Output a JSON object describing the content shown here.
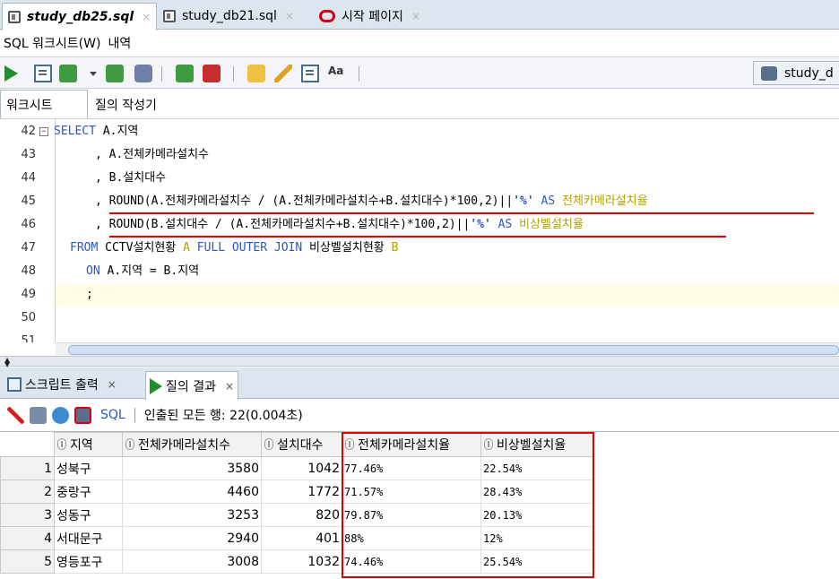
{
  "editor_tabs": [
    {
      "label": "study_db25.sql",
      "icon": "sql-file-icon",
      "active": true
    },
    {
      "label": "study_db21.sql",
      "icon": "sql-file-icon",
      "active": false
    },
    {
      "label": "시작 페이지",
      "icon": "oracle-icon",
      "active": false
    }
  ],
  "tab_close_glyph": "×",
  "sub_tabs": {
    "worksheet_w": "SQL 워크시트(W)",
    "history": "내역"
  },
  "toolbar": {
    "icons": [
      "run-statement-icon",
      "run-script-icon",
      "commit-icon",
      "rollback-icon",
      "explain-plan-icon",
      "autotrace-icon",
      "sql-tuning-icon",
      "clear-icon",
      "history-icon",
      "format-icon"
    ],
    "connection": "study_d"
  },
  "worksheet_tabs": {
    "worksheet": "워크시트",
    "query_builder": "질의 작성기"
  },
  "code": {
    "line_numbers": [
      "42",
      "43",
      "44",
      "45",
      "46",
      "47",
      "48",
      "49",
      "50",
      "51"
    ],
    "fold_glyph": "−",
    "l42_kw": "SELECT",
    "l42_rest": " A.지역",
    "l43": ", A.전체카메라설치수",
    "l44": ", B.설치대수",
    "l45_lead": ", ",
    "l45_body": "ROUND(A.전체카메라설치수 / (A.전체카메라설치수+B.설치대수)*100,2)||",
    "l45_str": "'%'",
    "l45_as": " AS ",
    "l45_alias": "전체카메라설치율",
    "l46_lead": ", ",
    "l46_body": "ROUND(B.설치대수 / (A.전체카메라설치수+B.설치대수)*100,2)||",
    "l46_str": "'%'",
    "l46_as": " AS ",
    "l46_alias": "비상벨설치율",
    "l47_kw1": "FROM",
    "l47_t1": " CCTV설치현황 ",
    "l47_a1": "A",
    "l47_kw2": " FULL OUTER JOIN",
    "l47_t2": " 비상벨설치현황 ",
    "l47_a2": "B",
    "l48_kw": "ON",
    "l48_rest": " A.지역 = B.지역",
    "l49": ";"
  },
  "result_tabs": {
    "script_output": "스크립트 출력",
    "query_result": "질의 결과",
    "close": "×"
  },
  "result_toolbar": {
    "icons": [
      "pin-icon",
      "print-icon",
      "refresh-icon",
      "cancel-icon"
    ],
    "sql_label": "SQL",
    "status": "인출된 모든 행: 22(0.004초)"
  },
  "result_grid": {
    "columns": [
      "지역",
      "전체카메라설치수",
      "설치대수",
      "전체카메라설치율",
      "비상벨설치율"
    ],
    "rows": [
      {
        "n": "1",
        "region": "성북구",
        "cameras": "3580",
        "bells": "1042",
        "cam_rate": "77.46%",
        "bell_rate": "22.54%"
      },
      {
        "n": "2",
        "region": "중랑구",
        "cameras": "4460",
        "bells": "1772",
        "cam_rate": "71.57%",
        "bell_rate": "28.43%"
      },
      {
        "n": "3",
        "region": "성동구",
        "cameras": "3253",
        "bells": "820",
        "cam_rate": "79.87%",
        "bell_rate": "20.13%"
      },
      {
        "n": "4",
        "region": "서대문구",
        "cameras": "2940",
        "bells": "401",
        "cam_rate": "88%",
        "bell_rate": "12%"
      },
      {
        "n": "5",
        "region": "영등포구",
        "cameras": "3008",
        "bells": "1032",
        "cam_rate": "74.46%",
        "bell_rate": "25.54%"
      }
    ]
  },
  "colors": {
    "keyword": "#2a56c6",
    "alias": "#b2a000",
    "annotation": "#e00000",
    "run": "#1d8f2c"
  }
}
